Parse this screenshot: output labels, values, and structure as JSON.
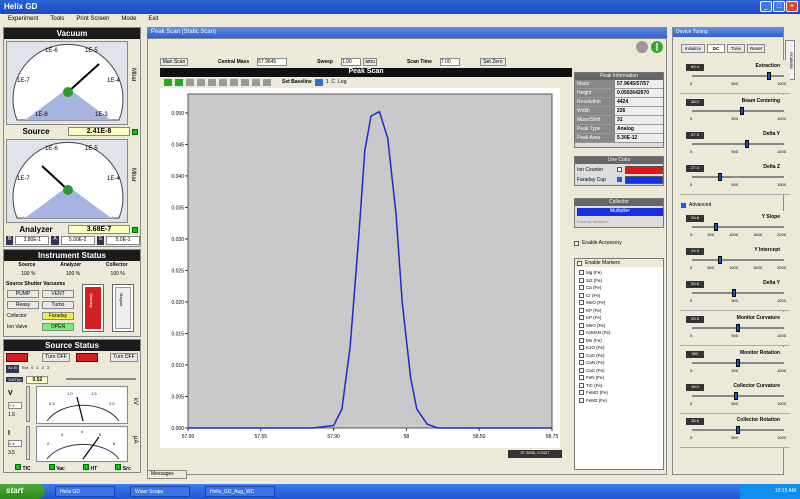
{
  "window": {
    "title": "Helix GD"
  },
  "menu": [
    "Experiment",
    "Tools",
    "Print Screen",
    "Mode",
    "Exit"
  ],
  "vacuum": {
    "title": "Vacuum",
    "gauge_labels": [
      "1E-6",
      "1E-5",
      "1E-7",
      "1E-4",
      "1E-8",
      "1E-3"
    ],
    "source_label": "Source",
    "source_value": "2.41E-8",
    "analyzer_label": "Analyzer",
    "analyzer_value": "3.68E-7",
    "small_labels": [
      "B",
      "A",
      "S"
    ],
    "small_values": [
      "3.80E-1",
      "5.00E-2",
      "5.0E-1"
    ],
    "side_label": "Mbar"
  },
  "instrument_status": {
    "title": "Instrument Status",
    "headers": [
      "Source",
      "Analyzer",
      "Collector"
    ],
    "percents": [
      "100 %",
      "100 %",
      "100 %"
    ],
    "valves_title": "Source Shutter Vacuums",
    "pump_label": "PUMP",
    "vent_label": "VENT",
    "row2": [
      "Reasy",
      "Turbo"
    ],
    "collector_label": "Collector",
    "collector_value": "Faraday",
    "ion_valve_label": "Ion Valve",
    "ion_valve_value": "OPEN",
    "bar_labels": [
      "Standby",
      "Magnet"
    ]
  },
  "source_status": {
    "title": "Source Status",
    "btn1": "Turn OFF",
    "btn2": "Turn OFF",
    "labels": [
      "Ac El",
      "Ext",
      "Vol/Trip"
    ],
    "value": "0.52",
    "scale": [
      "0",
      "1",
      "2",
      "3"
    ],
    "v_label": "V",
    "v_value": "7.2",
    "v_sub": "1.6",
    "i_label": "I",
    "i_value": "2.4",
    "i_sub": "3.5",
    "meter_scale": [
      "0.5",
      "1.0",
      "1.5",
      "2.0"
    ],
    "meter2_scale": [
      "2",
      "3",
      "4",
      "5",
      "6"
    ],
    "side_labels": [
      "kV",
      "μA"
    ],
    "status_items": [
      "TIC",
      "Vac",
      "HT",
      "Src"
    ]
  },
  "peak_scan": {
    "window_title": "Peak Scan (Static Scan)",
    "btn_scan": "Man Scan",
    "central_mass_label": "Central Mass",
    "central_mass_value": "57.9645",
    "sweep_label": "Sweep",
    "sweep_value": "1.00",
    "sweep_unit": "amu",
    "scan_time_label": "Scan Time",
    "scan_time_value": "7.00",
    "set_zero": "Set Zero",
    "plot_title": "Peak Scan",
    "set_baseline": "Set Baseline",
    "toolbar_extra": [
      "1",
      "C",
      "Log"
    ],
    "status_readout": "57.9635, 0.0427",
    "tab_label": "Messages"
  },
  "peak_info": {
    "title": "Peak Information",
    "rows": [
      {
        "k": "Mass",
        "v": "57.9645/57/57"
      },
      {
        "k": "Height",
        "v": "0.0502642670"
      },
      {
        "k": "Resolution",
        "v": "4424"
      },
      {
        "k": "Width",
        "v": "226"
      },
      {
        "k": "Mass/Shift",
        "v": "31"
      },
      {
        "k": "Peak Type",
        "v": "Analog"
      },
      {
        "k": "Peak Area",
        "v": "5.30E-12"
      }
    ]
  },
  "line_color": {
    "title": "Line Color",
    "ion_counter": "Ion Counter",
    "faraday_cup": "Faraday Cup",
    "ion_color": "#ee1111",
    "faraday_color": "#1133ee"
  },
  "collector_panel": {
    "title": "Collector",
    "selected": "Multiplier",
    "option2": "Faraday Multiplier"
  },
  "enable_elements": {
    "accessory_label": "Enable Accessory",
    "label": "Enable Markers",
    "items": [
      "Mg (Fe)",
      "Si2 (Fe)",
      "Ca (Fe)",
      "Cr (Fe)",
      "MnO (Fe)",
      "KP (Fe)",
      "KP (Fe)",
      "MnO (Fe)",
      "noMAN (Fe)",
      "Mn (Fe)",
      "K2O (Fe)",
      "CaC (Fe)",
      "CaN (Fe)",
      "CaC (Fe)",
      "FeN (Fe)",
      "TiC (Fe)",
      "FeMO (Fe)",
      "FeM2 (Fe)"
    ]
  },
  "device_tuning": {
    "title": "Device Tuning",
    "tabs": [
      "Initialize",
      "DC",
      "Tune",
      "Reset"
    ],
    "side_tab": "Analysis",
    "advanced_label": "Advanced",
    "sliders": [
      {
        "name": "Extraction",
        "value": "83.4",
        "pos": 0.85,
        "ticks": [
          "0",
          "500",
          "1000"
        ]
      },
      {
        "name": "Beam Centering",
        "value": "48.0",
        "pos": 0.55,
        "ticks": [
          "0",
          "500",
          "1000"
        ]
      },
      {
        "name": "Delta Y",
        "value": "57.3",
        "pos": 0.6,
        "ticks": [
          "0",
          "500",
          "1000"
        ]
      },
      {
        "name": "Delta Z",
        "value": "27.4",
        "pos": 0.3,
        "ticks": [
          "0",
          "500",
          "1000"
        ]
      },
      {
        "name": "Y Slope",
        "value": "26.8",
        "pos": 0.25,
        "ticks": [
          "0",
          "500",
          "1000",
          "1500",
          "2000"
        ]
      },
      {
        "name": "Y Intercept",
        "value": "24.3",
        "pos": 0.3,
        "ticks": [
          "0",
          "500",
          "1000",
          "1500",
          "2000"
        ]
      },
      {
        "name": "Delta Y",
        "value": "55.8",
        "pos": 0.45,
        "ticks": [
          "0",
          "500",
          "1000"
        ]
      },
      {
        "name": "Monitor Curvature",
        "value": "49.5",
        "pos": 0.5,
        "ticks": [
          "0",
          "500",
          "1000"
        ]
      },
      {
        "name": "Monitor Rotation",
        "value": "500",
        "pos": 0.5,
        "ticks": [
          "0",
          "500",
          "1000"
        ]
      },
      {
        "name": "Collector Curvature",
        "value": "48.0",
        "pos": 0.48,
        "ticks": [
          "0",
          "500",
          "1000"
        ]
      },
      {
        "name": "Collector Rotation",
        "value": "48.8",
        "pos": 0.5,
        "ticks": [
          "0",
          "500",
          "1000"
        ]
      }
    ]
  },
  "taskbar": {
    "start": "start",
    "tasks": [
      "Helix GD",
      "Wiser Scope",
      "Helix_GD_Aug_WC"
    ],
    "clock": "10:15 AM"
  },
  "chart_data": {
    "type": "line",
    "title": "Peak Scan",
    "x_ticks": [
      "57.00",
      "57.55",
      "57.90",
      "58",
      "58.50",
      "58.75"
    ],
    "y_ticks": [
      "0.000",
      "0.005",
      "0.010",
      "0.015",
      "0.020",
      "0.025",
      "0.030",
      "0.035",
      "0.040",
      "0.045",
      "0.050"
    ],
    "xlim": [
      57.0,
      58.75
    ],
    "ylim": [
      0,
      0.053
    ],
    "series": [
      {
        "color": "#1c2ccc",
        "x": [
          57.0,
          57.6,
          57.7,
          57.74,
          57.78,
          57.82,
          57.85,
          57.88,
          57.92,
          57.96,
          58.0,
          58.03,
          58.07,
          58.1,
          58.15,
          58.2,
          58.75
        ],
        "y": [
          0.0,
          0.0,
          0.0004,
          0.003,
          0.013,
          0.03,
          0.044,
          0.0495,
          0.0502,
          0.046,
          0.034,
          0.02,
          0.008,
          0.003,
          0.0006,
          0.0,
          0.0
        ]
      }
    ]
  }
}
